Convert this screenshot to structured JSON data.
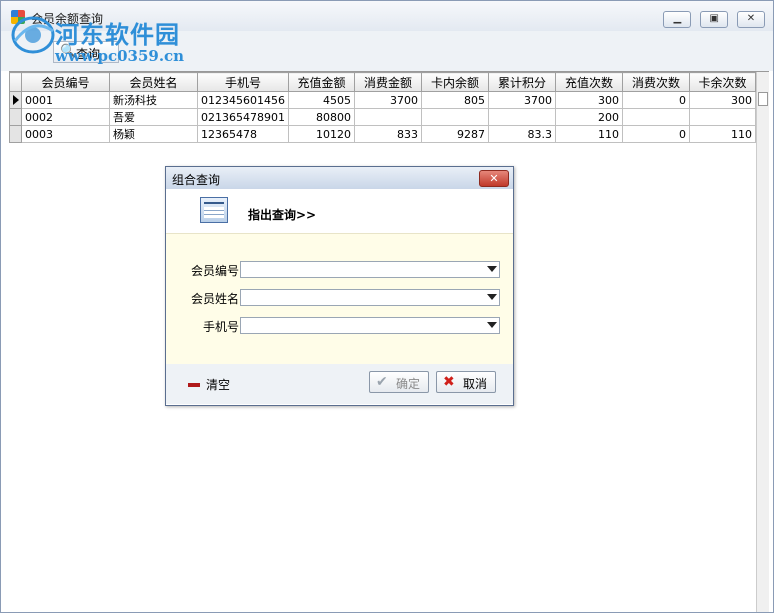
{
  "window": {
    "title": "会员余额查询",
    "minimize_icon": "minimize-icon",
    "maximize_icon": "maximize-icon",
    "close_icon": "close-icon"
  },
  "watermark": {
    "text": "河东软件园",
    "url": "www.pc0359.cn"
  },
  "toolbar": {
    "query_label": "查询",
    "query_icon": "search-icon"
  },
  "grid": {
    "columns": [
      "会员编号",
      "会员姓名",
      "手机号",
      "充值金额",
      "消费金额",
      "卡内余额",
      "累计积分",
      "充值次数",
      "消费次数",
      "卡余次数"
    ],
    "rows": [
      [
        "0001",
        "新汤科技",
        "012345601456",
        "4505",
        "3700",
        "805",
        "3700",
        "300",
        "0",
        "300"
      ],
      [
        "0002",
        "吾爱",
        "021365478901",
        "80800",
        "",
        "",
        "",
        "200",
        "",
        ""
      ],
      [
        "0003",
        "杨颖",
        "12365478",
        "10120",
        "833",
        "9287",
        "83.3",
        "110",
        "0",
        "110"
      ]
    ],
    "selected_row": 0
  },
  "dialog": {
    "title": "组合查询",
    "heading": "指出查询>>",
    "fields": [
      {
        "label": "会员编号",
        "value": ""
      },
      {
        "label": "会员姓名",
        "value": ""
      },
      {
        "label": "手机号",
        "value": ""
      }
    ],
    "clear_label": "清空",
    "ok_label": "确定",
    "cancel_label": "取消",
    "colors": {
      "body_bg": "#fffde8",
      "close_bg": "#c0392b"
    }
  }
}
